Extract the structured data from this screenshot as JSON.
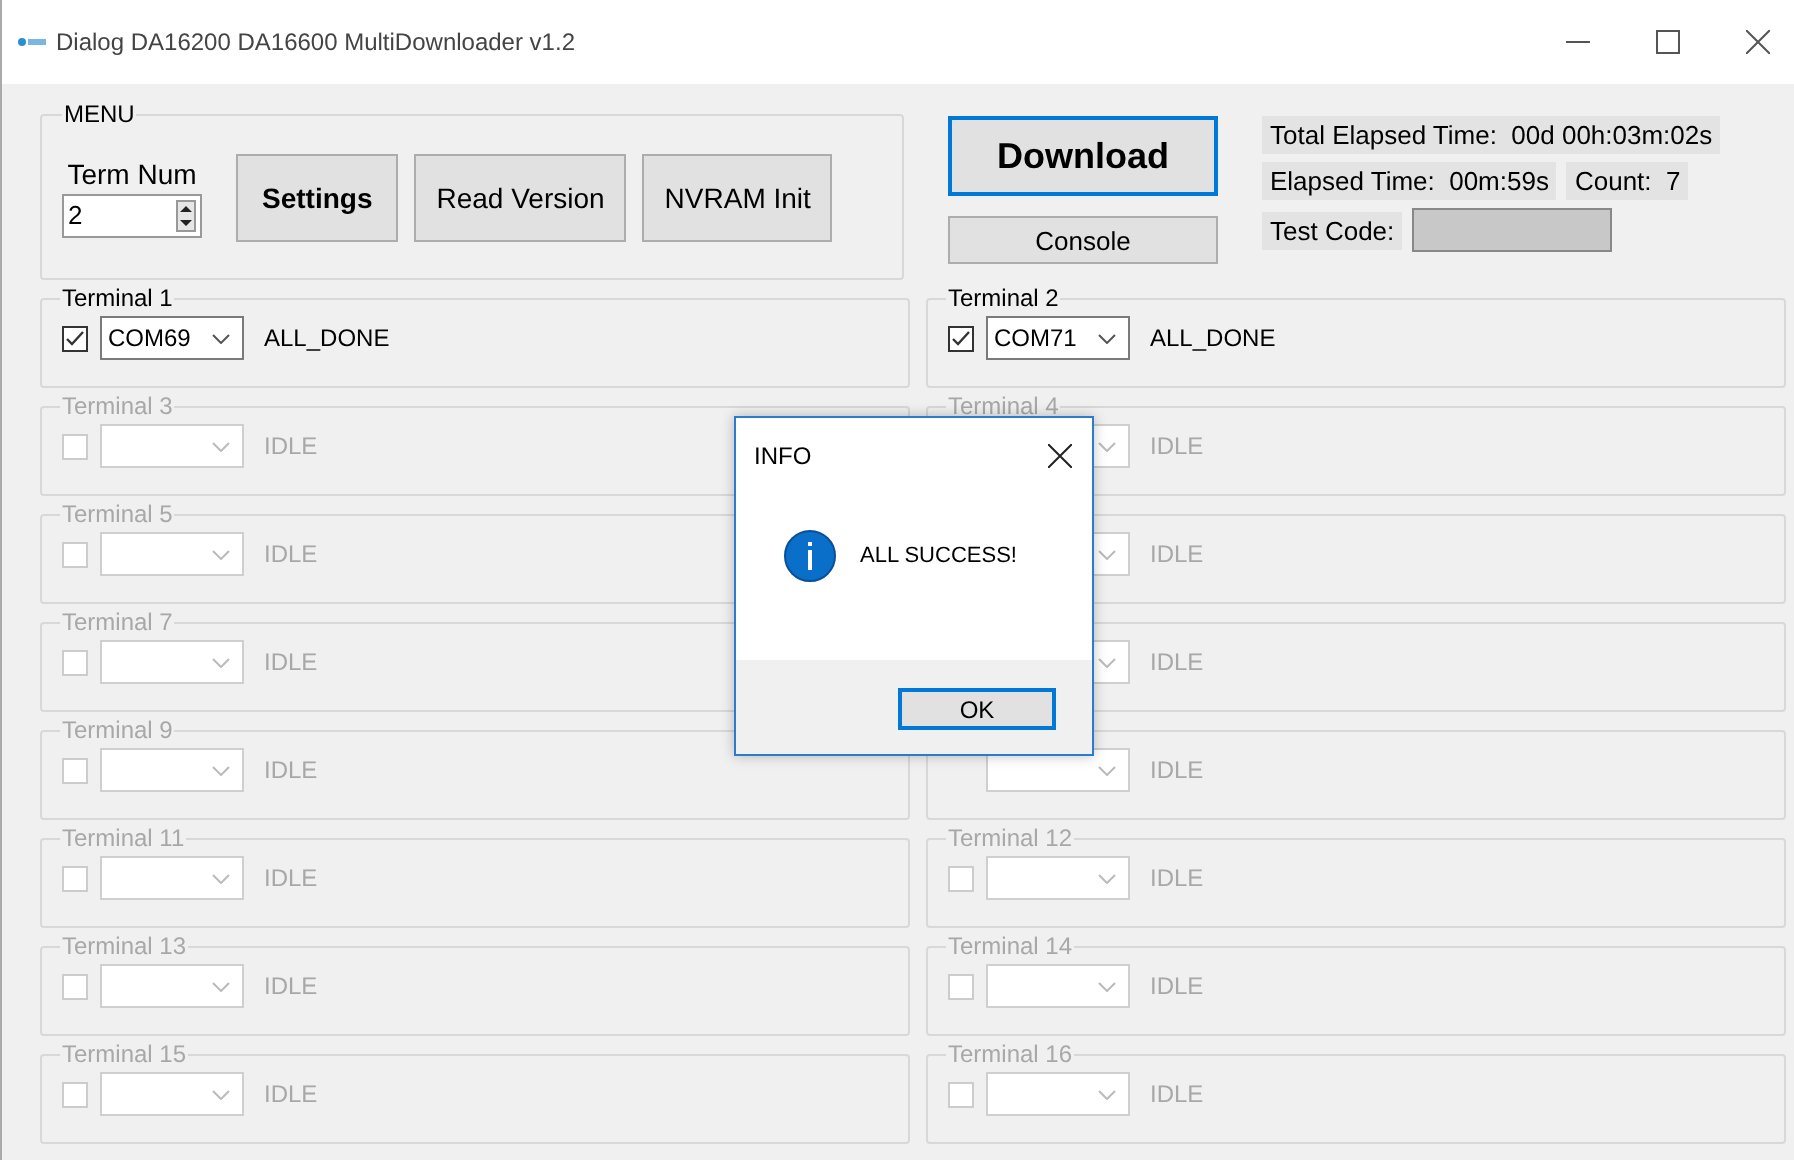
{
  "window": {
    "title": "Dialog DA16200 DA16600 MultiDownloader v1.2"
  },
  "menu": {
    "title": "MENU",
    "term_num_label": "Term Num",
    "term_num_value": "2",
    "buttons": [
      {
        "label": "Settings",
        "bold": true
      },
      {
        "label": "Read Version",
        "bold": false
      },
      {
        "label": "NVRAM Init",
        "bold": false
      }
    ]
  },
  "download_button": {
    "label": "Download",
    "focused": true
  },
  "console_button": {
    "label": "Console"
  },
  "info": {
    "total_elapsed": "Total Elapsed Time:  00d 00h:03m:02s",
    "elapsed": "Elapsed Time:  00m:59s",
    "count": "Count:  7",
    "test_code_label": "Test Code:"
  },
  "terminals": [
    {
      "label": "Terminal 1",
      "checked": true,
      "enabled": true,
      "port": "COM69",
      "status": "ALL_DONE"
    },
    {
      "label": "Terminal 2",
      "checked": true,
      "enabled": true,
      "port": "COM71",
      "status": "ALL_DONE"
    },
    {
      "label": "Terminal 3",
      "checked": false,
      "enabled": false,
      "status": "IDLE"
    },
    {
      "label": "Terminal 4",
      "enabled": false,
      "status": "IDLE"
    },
    {
      "label": "Terminal 5",
      "checked": false,
      "enabled": false,
      "status": "IDLE"
    },
    {
      "enabled": false,
      "status": "IDLE"
    },
    {
      "label": "Terminal 7",
      "checked": false,
      "enabled": false,
      "status": "IDLE"
    },
    {
      "enabled": false,
      "status": "IDLE"
    },
    {
      "label": "Terminal 9",
      "checked": false,
      "enabled": false,
      "status": "IDLE"
    },
    {
      "enabled": false,
      "status": "IDLE"
    },
    {
      "label": "Terminal 11",
      "checked": false,
      "enabled": false,
      "status": "IDLE"
    },
    {
      "label": "Terminal 12",
      "checked": false,
      "enabled": false,
      "status": "IDLE"
    },
    {
      "label": "Terminal 13",
      "checked": false,
      "enabled": false,
      "status": "IDLE"
    },
    {
      "label": "Terminal 14",
      "checked": false,
      "enabled": false,
      "status": "IDLE"
    },
    {
      "label": "Terminal 15",
      "checked": false,
      "enabled": false,
      "status": "IDLE"
    },
    {
      "label": "Terminal 16",
      "checked": false,
      "enabled": false,
      "status": "IDLE"
    }
  ],
  "dialog": {
    "title": "INFO",
    "message": "ALL SUCCESS!",
    "button": "OK"
  }
}
